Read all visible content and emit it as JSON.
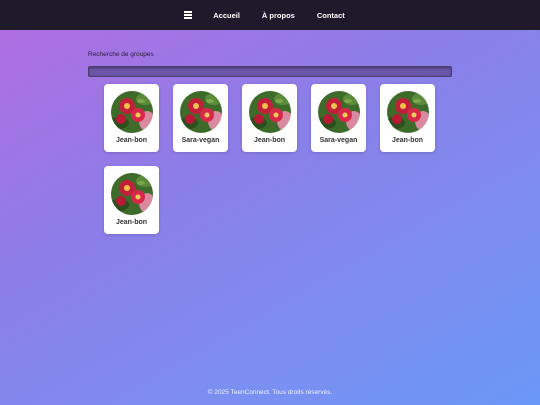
{
  "nav": {
    "menu_icon": "hamburger-menu-icon",
    "links": [
      "Accueil",
      "À propos",
      "Contact"
    ]
  },
  "search": {
    "label": "Recherche de groupes",
    "value": "",
    "placeholder": ""
  },
  "groups": [
    {
      "name": "Jean-bon",
      "avatar": "flower-photo"
    },
    {
      "name": "Sara-vegan",
      "avatar": "flower-photo"
    },
    {
      "name": "Jean-bon",
      "avatar": "flower-photo"
    },
    {
      "name": "Sara-vegan",
      "avatar": "flower-photo"
    },
    {
      "name": "Jean-bon",
      "avatar": "flower-photo"
    },
    {
      "name": "Jean-bon",
      "avatar": "flower-photo"
    }
  ],
  "footer": {
    "text": "© 2025 TeenConnect. Tous droits réservés."
  },
  "colors": {
    "topbar": "#1f1a2b",
    "gradient_start": "#b46ce0",
    "gradient_end": "#6a98f6",
    "card": "#ffffff"
  }
}
